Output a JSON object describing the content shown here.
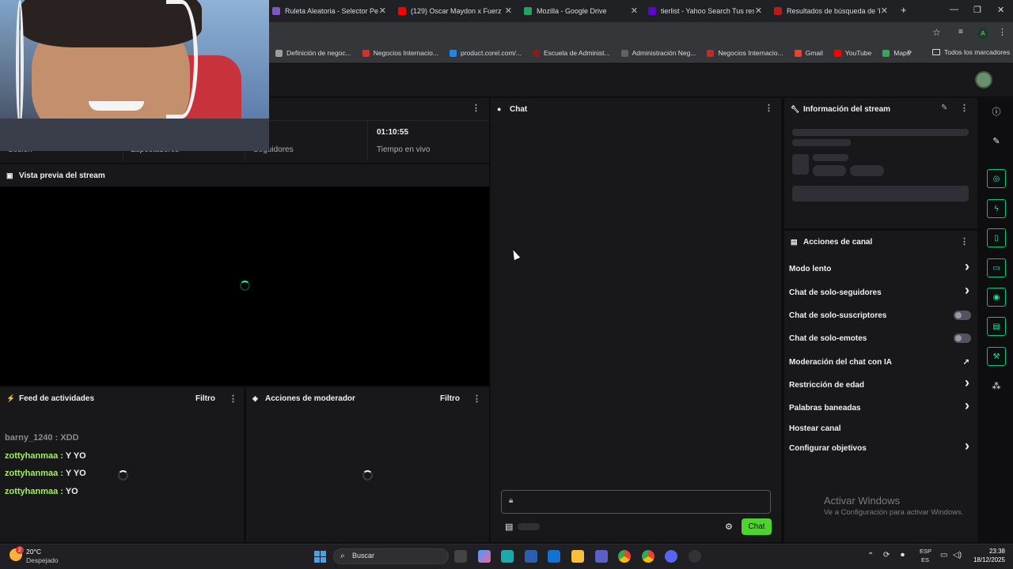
{
  "browser": {
    "tabs": [
      {
        "title": "Ruleta Aleatoria - Selector Pers",
        "color": "#7e57c2"
      },
      {
        "title": "(129) Oscar Maydon x Fuerz",
        "color": "#ff0000"
      },
      {
        "title": "Mozilla - Google Drive",
        "color": "#1fa463"
      },
      {
        "title": "tierlist - Yahoo Search Tus resul",
        "color": "#6001d2"
      },
      {
        "title": "Resultados de búsqueda de 'KO",
        "color": "#b71c1c"
      }
    ],
    "new_tab": "+",
    "bookmarks": [
      {
        "label": "Definición de negoc...",
        "color": "#9e9e9e"
      },
      {
        "label": "Negocios Internacio...",
        "color": "#d32f2f"
      },
      {
        "label": "product.corel.com/...",
        "color": "#1e88e5"
      },
      {
        "label": "Escuela de Administ...",
        "color": "#8e1b1b"
      },
      {
        "label": "Administración Neg...",
        "color": "#616161"
      },
      {
        "label": "Negocios Internacio...",
        "color": "#c62828"
      },
      {
        "label": "Gmail",
        "color": "#ea4335"
      },
      {
        "label": "YouTube",
        "color": "#ff0000"
      },
      {
        "label": "Maps",
        "color": "#34a853"
      }
    ],
    "bookmarks_more": "»",
    "all_bookmarks": "Todos los marcadores",
    "profile_letter": "A"
  },
  "stats": {
    "labels": [
      "Sesión",
      "Espectadores",
      "Seguidores",
      "Tiempo en vivo"
    ],
    "live_time": "01:10:55"
  },
  "preview": {
    "title": "Vista previa del stream"
  },
  "feed": {
    "title": "Feed de actividades",
    "filter": "Filtro",
    "messages": [
      {
        "user": "barny_1240",
        "text": "XDD",
        "color": "#8a8a8a"
      },
      {
        "user": "zottyhanmaa",
        "text": "Y YO",
        "color": "#9ef25a"
      },
      {
        "user": "zottyhanmaa",
        "text": "Y YO",
        "color": "#9ef25a"
      },
      {
        "user": "zottyhanmaa",
        "text": "YO",
        "color": "#9ef25a"
      }
    ],
    "separator": " : "
  },
  "mod_actions": {
    "title": "Acciones de moderador",
    "filter": "Filtro"
  },
  "chat": {
    "title": "Chat",
    "button": "Chat",
    "accent": "#4fd42f"
  },
  "stream_info": {
    "title": "Información del stream"
  },
  "channel_actions": {
    "title": "Acciones de canal",
    "items": [
      {
        "label": "Modo lento",
        "control": "chevron"
      },
      {
        "label": "Chat de solo-seguidores",
        "control": "chevron"
      },
      {
        "label": "Chat de solo-suscriptores",
        "control": "toggle"
      },
      {
        "label": "Chat de solo-emotes",
        "control": "toggle"
      },
      {
        "label": "Moderación del chat con IA",
        "control": "external"
      },
      {
        "label": "Restricción de edad",
        "control": "chevron"
      },
      {
        "label": "Palabras baneadas",
        "control": "chevron"
      },
      {
        "label": "Hostear canal",
        "control": "none"
      },
      {
        "label": "Configurar objetivos",
        "control": "chevron"
      }
    ]
  },
  "watermark": {
    "title": "Activar Windows",
    "subtitle": "Ve a Configuración para activar Windows."
  },
  "taskbar": {
    "weather_temp": "20°C",
    "weather_desc": "Despejado",
    "weather_badge": "2",
    "search_placeholder": "Buscar",
    "lang_top": "ESP",
    "lang_bottom": "ES",
    "time": "23:38",
    "date": "18/12/2025"
  }
}
